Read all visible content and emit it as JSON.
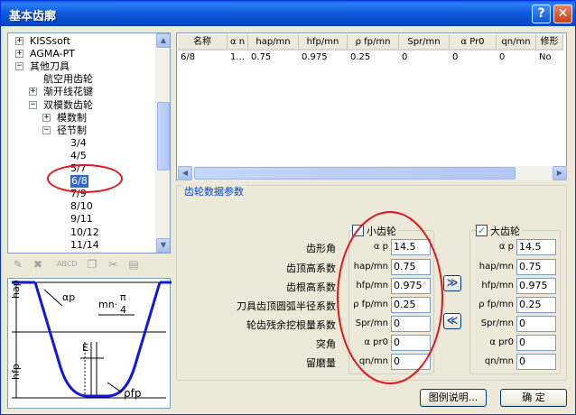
{
  "window": {
    "title": "基本齿廓",
    "help_label": "?",
    "close_label": "✕"
  },
  "tree": {
    "items": [
      {
        "label": "KISSsoft",
        "expander": "+"
      },
      {
        "label": "AGMA-PT",
        "expander": "+"
      },
      {
        "label": "其他刀具",
        "expander": "−"
      },
      {
        "label": "航空用齿轮",
        "expander": ""
      },
      {
        "label": "渐开线花键",
        "expander": "+"
      },
      {
        "label": "双模数齿轮",
        "expander": "−"
      },
      {
        "label": "模数制",
        "expander": "+"
      },
      {
        "label": "径节制",
        "expander": "−"
      },
      {
        "label": "3/4",
        "expander": ""
      },
      {
        "label": "4/5",
        "expander": ""
      },
      {
        "label": "5/7",
        "expander": ""
      },
      {
        "label": "6/8",
        "expander": "",
        "selected": true
      },
      {
        "label": "7/9",
        "expander": ""
      },
      {
        "label": "8/10",
        "expander": ""
      },
      {
        "label": "9/11",
        "expander": ""
      },
      {
        "label": "10/12",
        "expander": ""
      },
      {
        "label": "11/14",
        "expander": ""
      }
    ],
    "scroll_up": "▲",
    "scroll_down": "▼"
  },
  "toolbar_icons": [
    "edit-icon",
    "delete-icon",
    "abcd-icon",
    "copy-icon",
    "cut-icon",
    "paste-icon"
  ],
  "diagram": {
    "hap": "hap",
    "hfp": "hfp",
    "alpha": "αp",
    "mn": "mn·",
    "pi": "π",
    "four": "4",
    "E": "E",
    "rho": "ρfp"
  },
  "table": {
    "columns": [
      "名称",
      "α n",
      "hap/mn",
      "hfp/mn",
      "ρ fp/mn",
      "Spr/mn",
      "α Pr0",
      "qn/mn",
      "修形"
    ],
    "rows": [
      [
        "6/8",
        "1...",
        "0.75",
        "0.975",
        "0.25",
        "0",
        "0",
        "0",
        "No"
      ]
    ],
    "scroll_left": "◀",
    "scroll_right": "▶"
  },
  "gear_params": {
    "title": "齿轮数据参数",
    "labels": [
      "齿形角",
      "齿顶高系数",
      "齿根高系数",
      "刀具齿顶圆弧半径系数",
      "轮齿残余挖根量系数",
      "突角",
      "留磨量"
    ],
    "symbols": [
      "α p",
      "hap/mn",
      "hfp/mn",
      "ρ fp/mn",
      "Spr/mn",
      "α pr0",
      "qn/mn"
    ],
    "small_gear": {
      "title": "小齿轮",
      "checked": true,
      "values": [
        "14.5",
        "0.75",
        "0.975",
        "0.25",
        "0",
        "0",
        "0"
      ]
    },
    "large_gear": {
      "title": "大齿轮",
      "checked": true,
      "values": [
        "14.5",
        "0.75",
        "0.975",
        "0.25",
        "0",
        "0",
        "0"
      ]
    },
    "copy_right_label": "≫",
    "copy_left_label": "≪"
  },
  "buttons": {
    "legend": "图例说明...",
    "ok": "确   定"
  }
}
